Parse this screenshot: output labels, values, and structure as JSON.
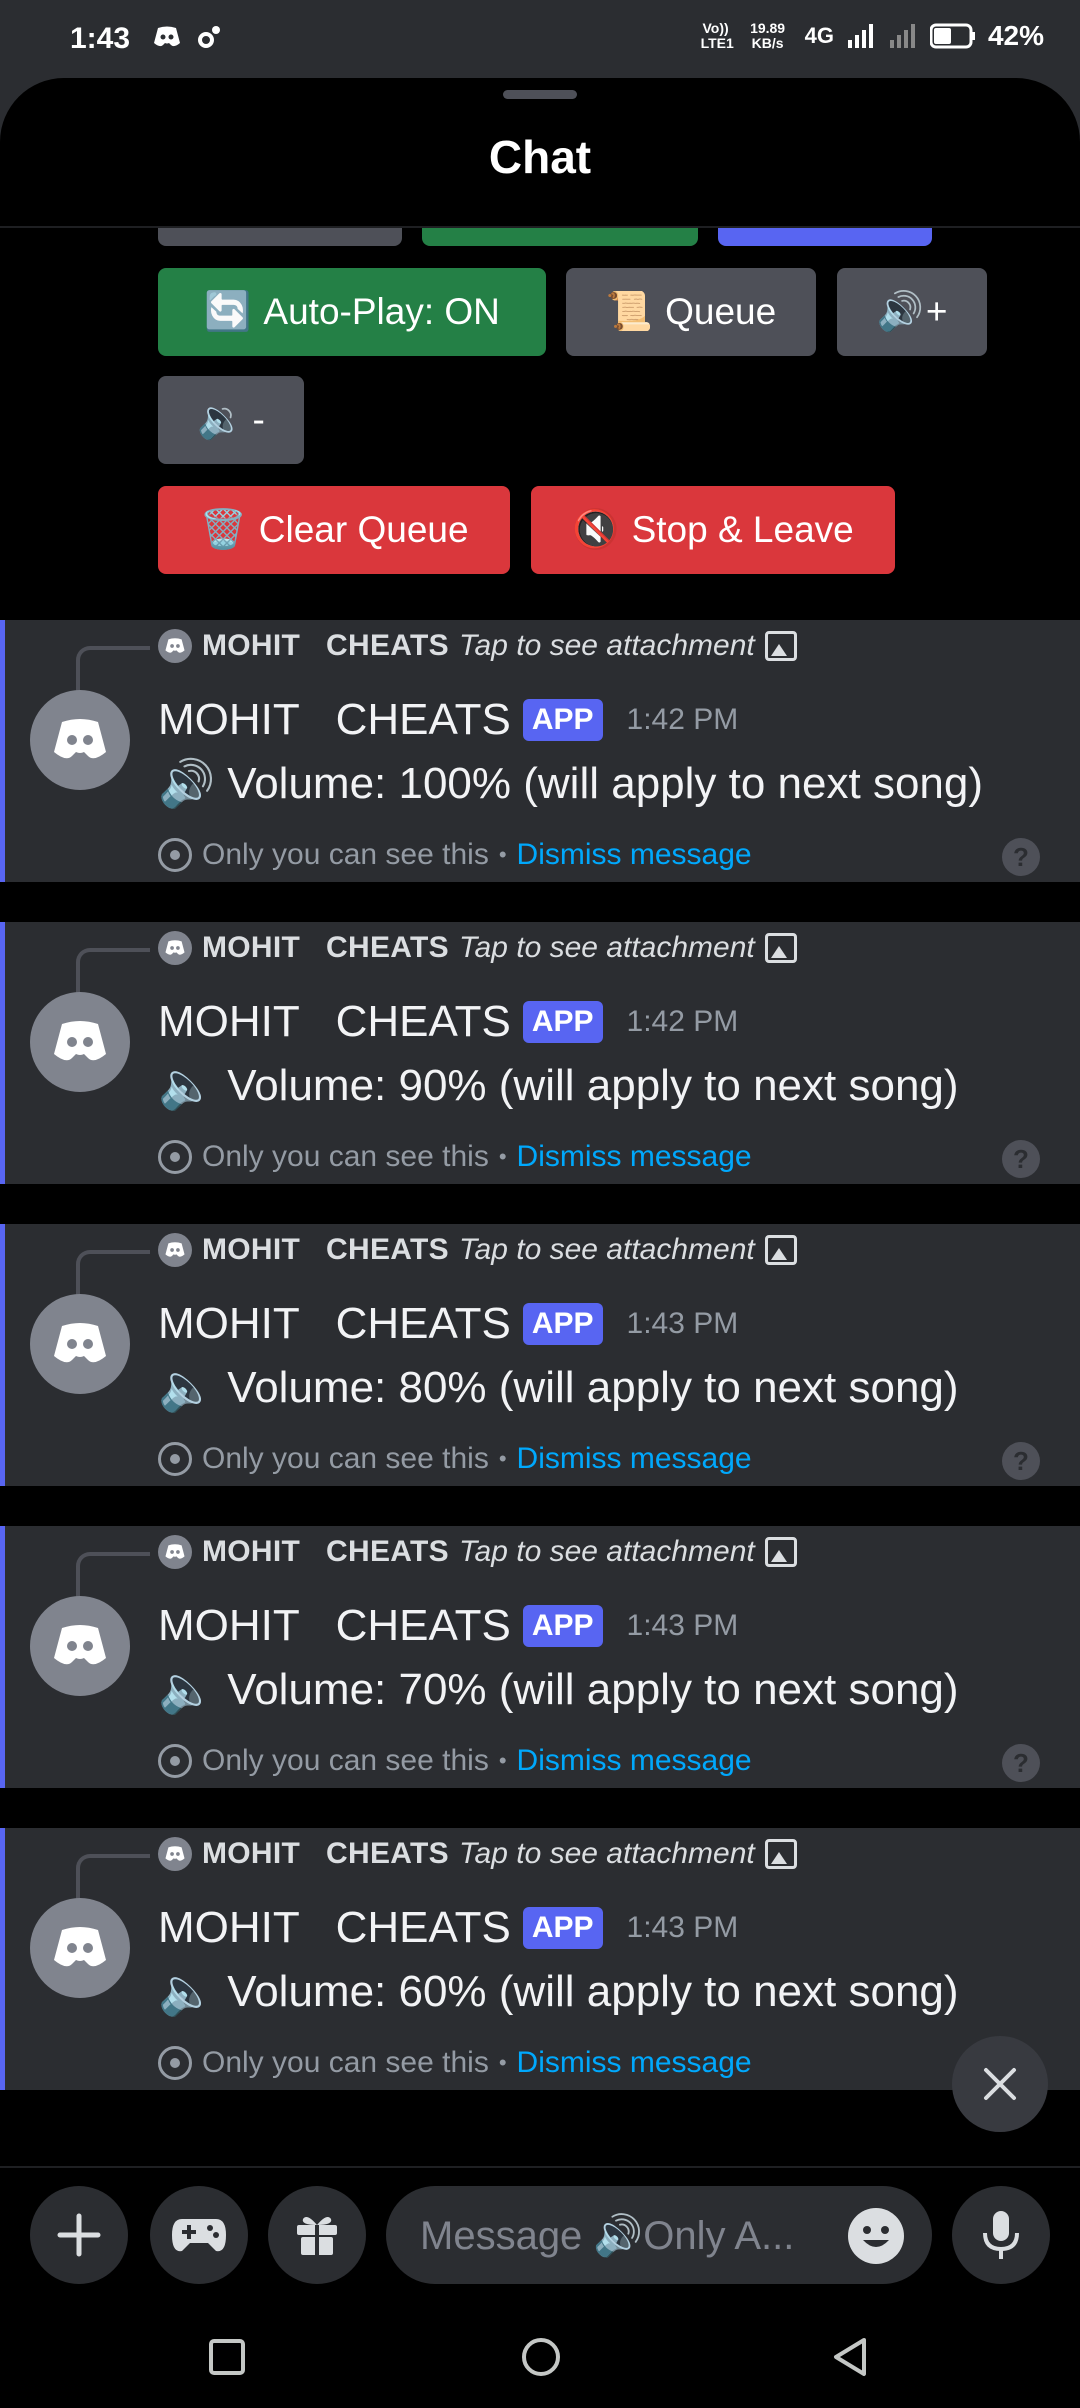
{
  "status_bar": {
    "time": "1:43",
    "volte": "Vo)) LTE1",
    "speed": "19.89 KB/s",
    "network": "4G",
    "battery": "42%"
  },
  "sheet": {
    "title": "Chat"
  },
  "buttons": {
    "autoplay": {
      "emoji": "🔄",
      "label": "Auto-Play: ON"
    },
    "queue": {
      "emoji": "📜",
      "label": "Queue"
    },
    "vol_up": {
      "emoji": "🔊",
      "label": "+"
    },
    "vol_down": {
      "emoji": "🔉",
      "label": "-"
    },
    "clear_queue": {
      "emoji": "🗑️",
      "label": "Clear Queue"
    },
    "stop_leave": {
      "emoji": "🔇",
      "label": "Stop & Leave"
    }
  },
  "messages": [
    {
      "reply_name": "MOHIT   CHEATS",
      "reply_attachment": "Tap to see attachment",
      "author": "MOHIT   CHEATS",
      "badge": "APP",
      "time": "1:42 PM",
      "emoji": "🔊",
      "text": "Volume: 100% (will apply to next song)",
      "ephemeral": "Only you can see this",
      "dismiss": "Dismiss message"
    },
    {
      "reply_name": "MOHIT   CHEATS",
      "reply_attachment": "Tap to see attachment",
      "author": "MOHIT   CHEATS",
      "badge": "APP",
      "time": "1:42 PM",
      "emoji": "🔈",
      "text": "Volume: 90% (will apply to next song)",
      "ephemeral": "Only you can see this",
      "dismiss": "Dismiss message"
    },
    {
      "reply_name": "MOHIT   CHEATS",
      "reply_attachment": "Tap to see attachment",
      "author": "MOHIT   CHEATS",
      "badge": "APP",
      "time": "1:43 PM",
      "emoji": "🔈",
      "text": "Volume: 80% (will apply to next song)",
      "ephemeral": "Only you can see this",
      "dismiss": "Dismiss message"
    },
    {
      "reply_name": "MOHIT   CHEATS",
      "reply_attachment": "Tap to see attachment",
      "author": "MOHIT   CHEATS",
      "badge": "APP",
      "time": "1:43 PM",
      "emoji": "🔈",
      "text": "Volume: 70% (will apply to next song)",
      "ephemeral": "Only you can see this",
      "dismiss": "Dismiss message"
    },
    {
      "reply_name": "MOHIT   CHEATS",
      "reply_attachment": "Tap to see attachment",
      "author": "MOHIT   CHEATS",
      "badge": "APP",
      "time": "1:43 PM",
      "emoji": "🔈",
      "text": "Volume: 60% (will apply to next song)",
      "ephemeral": "Only you can see this",
      "dismiss": "Dismiss message"
    }
  ],
  "composer": {
    "placeholder": "Message 🔊Only A..."
  },
  "colors": {
    "blurple": "#5865f2",
    "green": "#248046",
    "red": "#da373c",
    "link": "#00a8fc",
    "card": "#2b2d31"
  },
  "icons": [
    "discord-icon",
    "plus-icon",
    "gamepad-icon",
    "gift-icon",
    "emoji-icon",
    "mic-icon",
    "close-icon",
    "help-icon",
    "eye-icon",
    "image-icon"
  ]
}
